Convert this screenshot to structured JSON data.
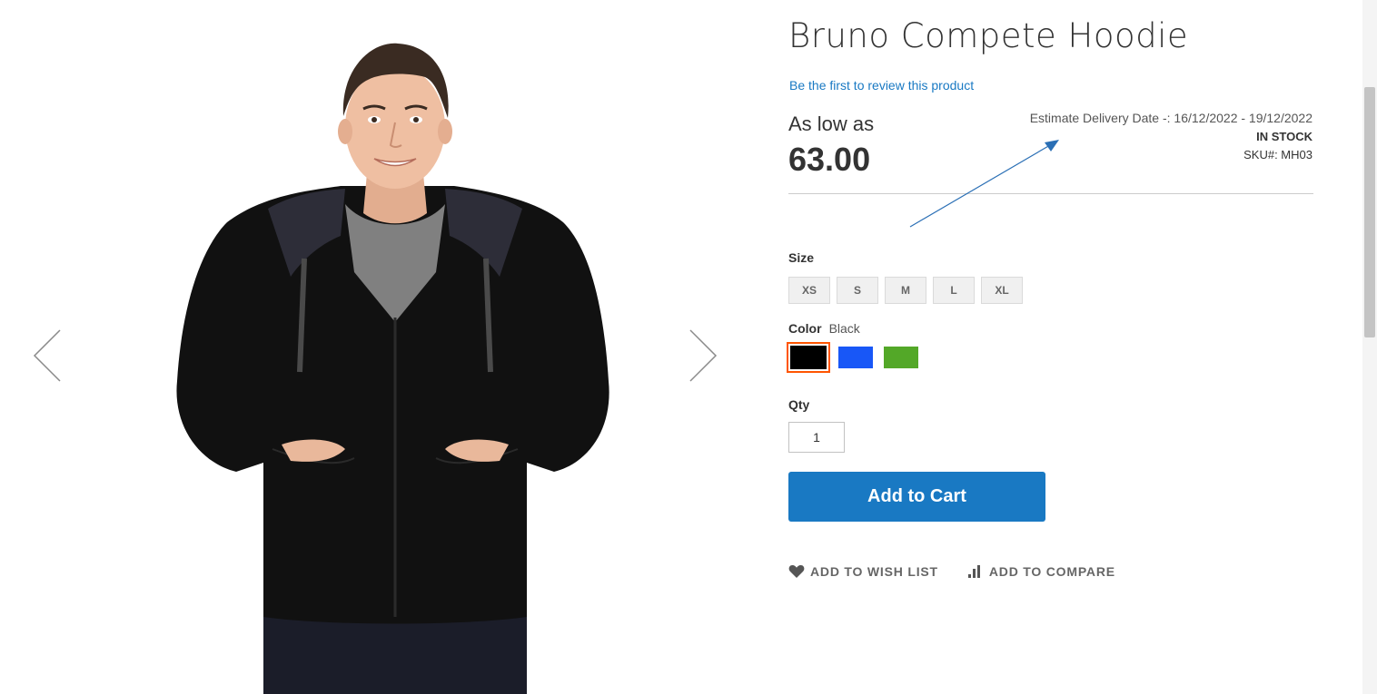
{
  "gallery": {
    "prev_icon": "chevron-left-icon",
    "next_icon": "chevron-right-icon",
    "image_alt": "Bruno Compete Hoodie"
  },
  "product": {
    "title": "Bruno Compete Hoodie",
    "review_link": "Be the first to review this product",
    "price_label": "As low as",
    "price": "63.00",
    "delivery_estimate": "Estimate Delivery Date -: 16/12/2022 - 19/12/2022",
    "stock_status": "In stock",
    "sku": "SKU#:  MH03"
  },
  "options": {
    "size_label": "Size",
    "sizes": [
      "XS",
      "S",
      "M",
      "L",
      "XL"
    ],
    "color_label": "Color",
    "color_selected": "Black",
    "colors": [
      {
        "name": "Black",
        "hex": "#000000",
        "selected": true
      },
      {
        "name": "Blue",
        "hex": "#1857f7",
        "selected": false
      },
      {
        "name": "Green",
        "hex": "#53a828",
        "selected": false
      }
    ],
    "qty_label": "Qty",
    "qty_value": "1"
  },
  "actions": {
    "add_to_cart": "Add to Cart",
    "wishlist": "Add to Wish List",
    "wishlist_icon": "heart-icon",
    "compare": "Add to Compare",
    "compare_icon": "bar-chart-icon"
  },
  "colors": {
    "accent": "#1979c3",
    "annotation": "#2a6fb5",
    "swatch_selected_outline": "#ff5501"
  }
}
